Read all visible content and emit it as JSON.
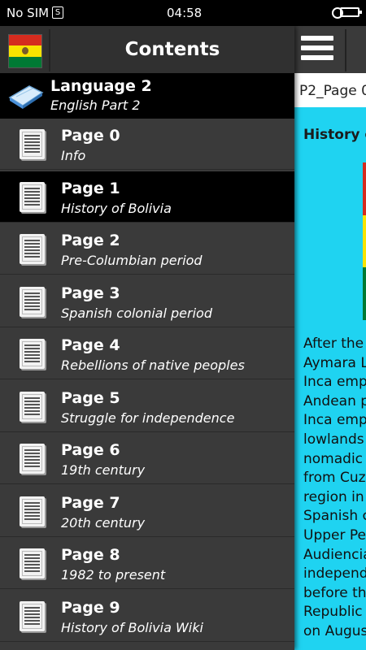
{
  "status": {
    "carrier": "No SIM",
    "sim_icon": "S",
    "time": "04:58"
  },
  "drawer": {
    "title": "Contents",
    "section": {
      "name": "Language 2",
      "sub": "English Part 2"
    },
    "items": [
      {
        "name": "Page 0",
        "sub": "Info"
      },
      {
        "name": "Page 1",
        "sub": "History of Bolivia",
        "active": true
      },
      {
        "name": "Page 2",
        "sub": "Pre-Columbian period"
      },
      {
        "name": "Page 3",
        "sub": "Spanish colonial period"
      },
      {
        "name": "Page 4",
        "sub": "Rebellions of native peoples"
      },
      {
        "name": "Page 5",
        "sub": "Struggle for independence"
      },
      {
        "name": "Page 6",
        "sub": "19th century"
      },
      {
        "name": "Page 7",
        "sub": "20th century"
      },
      {
        "name": "Page 8",
        "sub": "1982 to present"
      },
      {
        "name": "Page 9",
        "sub": "History of Bolivia Wiki"
      }
    ]
  },
  "content": {
    "page_label": "P2_Page 0",
    "heading": "History o",
    "lines": [
      "After the",
      "Aymara L",
      "Inca emp",
      "Andean p",
      "Inca emp",
      "lowlands",
      "nomadic",
      "from Cuz",
      "region in",
      "Spanish c",
      "Upper Pe",
      "Audiencia",
      "independ",
      "before th",
      "Republic",
      "on Augus"
    ]
  },
  "colors": {
    "accent": "#1fd3f1",
    "drawer_bg": "#3a3a3a",
    "active_bg": "#000000",
    "flag_red": "#d52b1e",
    "flag_yellow": "#f9e300",
    "flag_green": "#007934"
  }
}
